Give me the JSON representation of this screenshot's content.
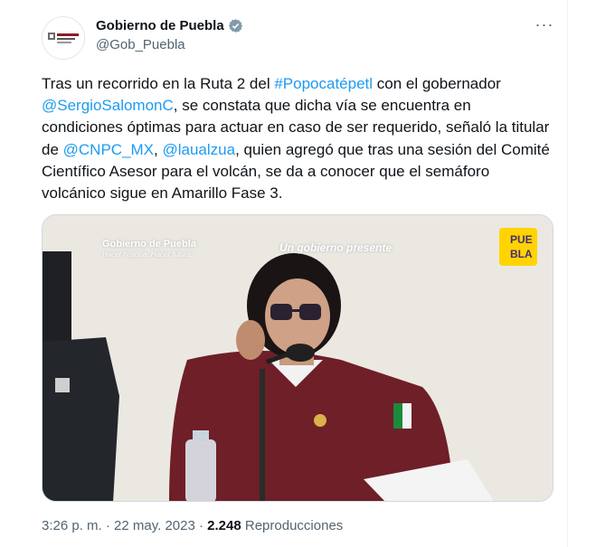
{
  "author": {
    "display_name": "Gobierno de Puebla",
    "handle": "@Gob_Puebla",
    "avatar_icon": "gobierno-puebla-logo",
    "verified_color": "#829aab"
  },
  "menu": {
    "more_label": "···"
  },
  "tweet": {
    "parts": [
      "Tras un recorrido en la Ruta 2 del ",
      "#Popocatépetl",
      " con el gobernador ",
      "@SergioSalomonC",
      ", se constata que dicha vía se encuentra en condiciones óptimas para actuar en caso de ser requerido, señaló la titular de ",
      "@CNPC_MX",
      ", ",
      "@laualzua",
      ", quien agregó que tras una sesión del Comité Científico Asesor para el volcán, se da a conocer que el semáforo volcánico sigue en Amarillo Fase 3."
    ],
    "link_color": "#1d9bf0"
  },
  "media": {
    "overlay_brand": "Gobierno de Puebla",
    "overlay_slogan": "Hacer historia. Hacer futuro.",
    "overlay_center": "Un gobierno presente",
    "overlay_logo_top": "PUE",
    "overlay_logo_bottom": "BLA"
  },
  "meta": {
    "time": "3:26 p. m.",
    "separator": " · ",
    "date": "22 may. 2023",
    "views_count": "2.248",
    "views_label": " Reproducciones"
  }
}
